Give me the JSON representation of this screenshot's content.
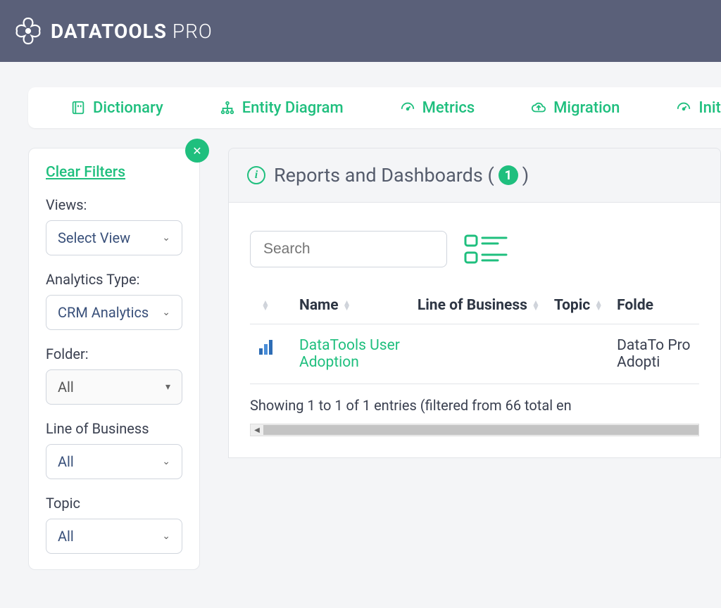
{
  "brand": {
    "bold": "DATATOOLS",
    "light": " PRO"
  },
  "nav": [
    {
      "label": "Dictionary",
      "icon": "dictionary"
    },
    {
      "label": "Entity Diagram",
      "icon": "diagram"
    },
    {
      "label": "Metrics",
      "icon": "gauge"
    },
    {
      "label": "Migration",
      "icon": "cloud"
    },
    {
      "label": "Initia",
      "icon": "gauge"
    }
  ],
  "filters": {
    "clear": "Clear Filters",
    "views": {
      "label": "Views:",
      "value": "Select View"
    },
    "analytics_type": {
      "label": "Analytics Type:",
      "value": "CRM Analytics"
    },
    "folder": {
      "label": "Folder:",
      "value": "All"
    },
    "lob": {
      "label": "Line of Business",
      "value": "All"
    },
    "topic": {
      "label": "Topic",
      "value": "All"
    }
  },
  "panel": {
    "title_prefix": "Reports and Dashboards (",
    "count": "1",
    "title_suffix": ")",
    "search_placeholder": "Search",
    "columns": {
      "name": "Name",
      "lob": "Line of Business",
      "topic": "Topic",
      "folder": "Folde"
    },
    "rows": [
      {
        "name": "DataTools User Adoption",
        "lob": "",
        "topic": "",
        "folder": "DataTo Pro Adopti"
      }
    ],
    "footer": "Showing 1 to 1 of 1 entries (filtered from 66 total en"
  }
}
